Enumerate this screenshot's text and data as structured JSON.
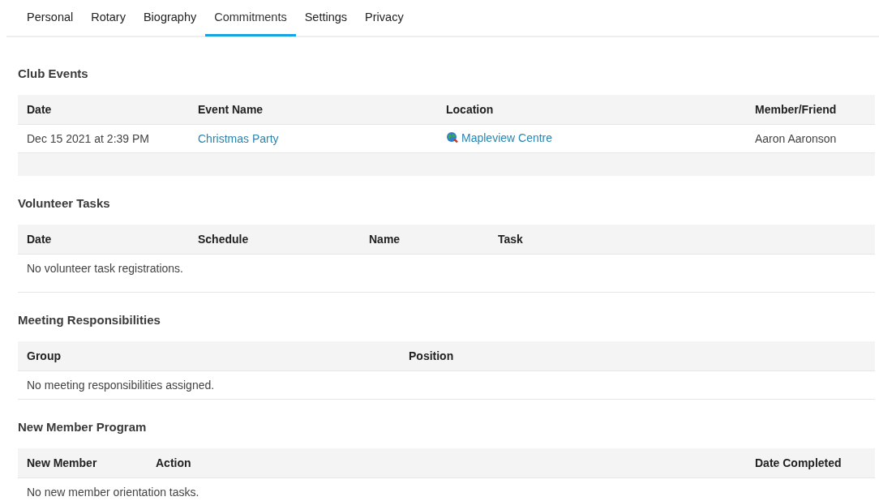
{
  "tabs": [
    {
      "label": "Personal",
      "selected": false
    },
    {
      "label": "Rotary",
      "selected": false
    },
    {
      "label": "Biography",
      "selected": false
    },
    {
      "label": "Commitments",
      "selected": true
    },
    {
      "label": "Settings",
      "selected": false
    },
    {
      "label": "Privacy",
      "selected": false
    }
  ],
  "sections": [
    {
      "title": "Club Events",
      "columns": [
        "Date",
        "Event Name",
        "Location",
        "Member/Friend"
      ],
      "rows": [
        [
          {
            "text": "Dec 15 2021 at 2:39 PM",
            "kind": "text"
          },
          {
            "text": "Christmas Party",
            "kind": "link"
          },
          {
            "text": "Mapleview Centre",
            "kind": "map-link"
          },
          {
            "text": "Aaron Aaronson",
            "kind": "text"
          }
        ]
      ]
    },
    {
      "title": "Volunteer Tasks",
      "columns": [
        "Date",
        "Schedule",
        "Name",
        "Task"
      ],
      "empty": "No volunteer task registrations."
    },
    {
      "title": "Meeting Responsibilities",
      "columns": [
        "Group",
        "Position"
      ],
      "empty": "No meeting responsibilities assigned."
    },
    {
      "title": "New Member Program",
      "columns": [
        "New Member",
        "Action",
        "Date Completed"
      ],
      "empty": "No new member orientation tasks."
    }
  ]
}
